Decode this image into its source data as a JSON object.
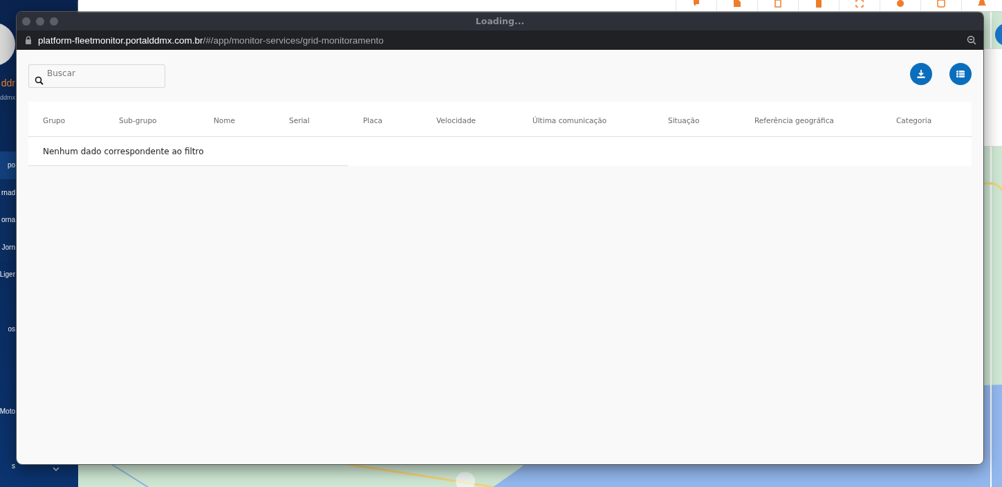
{
  "sidebar": {
    "user_name": "ddr",
    "user_email": "ddmx",
    "items": [
      {
        "label": "po",
        "kind": "item",
        "selected": true
      },
      {
        "label": "rnad",
        "kind": "subitem",
        "selected": false
      },
      {
        "label": "orna",
        "kind": "subitem",
        "selected": false
      },
      {
        "label": "Jorn",
        "kind": "subitem",
        "selected": false
      },
      {
        "label": "Liger",
        "kind": "item",
        "selected": false
      },
      {
        "label": "os",
        "kind": "item",
        "selected": false
      },
      {
        "label": "Moto",
        "kind": "item",
        "selected": false
      },
      {
        "label": "s",
        "kind": "group",
        "selected": false,
        "expanded": false
      }
    ]
  },
  "window": {
    "title": "Loading...",
    "url_host": "platform-fleetmonitor.portalddmx.com.br",
    "url_path": "/#/app/monitor-services/grid-monitoramento"
  },
  "search": {
    "placeholder": "Buscar"
  },
  "table": {
    "columns": [
      "Grupo",
      "Sub-grupo",
      "Nome",
      "Serial",
      "Placa",
      "Velocidade",
      "Última comunicação",
      "Situação",
      "Referência geográfica",
      "Categoria"
    ],
    "empty_message": "Nenhum dado correspondente ao filtro"
  }
}
